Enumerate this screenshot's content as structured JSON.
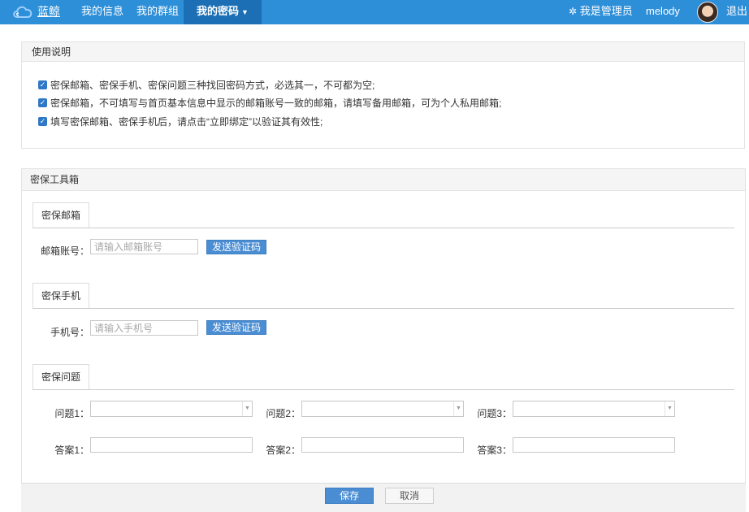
{
  "nav": {
    "brand": "蓝鲸",
    "items": [
      {
        "label": "我的信息"
      },
      {
        "label": "我的群组"
      },
      {
        "label": "我的密码"
      }
    ],
    "admin_label": "我是管理员",
    "username": "melody",
    "logout_label": "退出",
    "colors": {
      "bar": "#2e8fd9",
      "active": "#1c6fb4"
    }
  },
  "instructions": {
    "title": "使用说明",
    "notes": [
      "密保邮箱、密保手机、密保问题三种找回密码方式，必选其一，不可都为空;",
      "密保邮箱，不可填写与首页基本信息中显示的邮箱账号一致的邮箱，请填写备用邮箱，可为个人私用邮箱;",
      "填写密保邮箱、密保手机后，请点击“立即绑定”以验证其有效性;"
    ]
  },
  "toolbox": {
    "title": "密保工具箱",
    "email": {
      "tab": "密保邮箱",
      "label": "邮箱账号：",
      "placeholder": "请输入邮箱账号",
      "send_label": "发送验证码"
    },
    "phone": {
      "tab": "密保手机",
      "label": "手机号：",
      "placeholder": "请输入手机号",
      "send_label": "发送验证码"
    },
    "questions": {
      "tab": "密保问题",
      "question_labels": [
        "问题1：",
        "问题2：",
        "问题3："
      ],
      "answer_labels": [
        "答案1：",
        "答案2：",
        "答案3："
      ]
    }
  },
  "footer": {
    "save_label": "保存",
    "cancel_label": "取消"
  }
}
